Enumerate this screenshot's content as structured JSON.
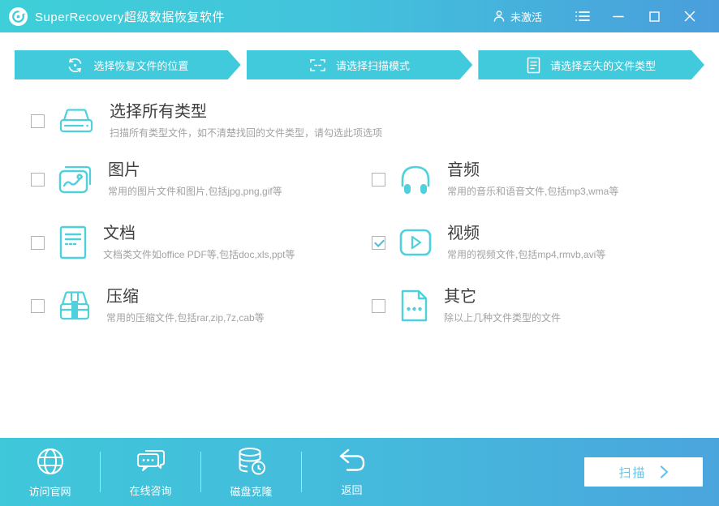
{
  "titlebar": {
    "title": "SuperRecovery超级数据恢复软件",
    "activation": "未激活"
  },
  "steps": [
    {
      "label": "选择恢复文件的位置"
    },
    {
      "label": "请选择扫描模式"
    },
    {
      "label": "请选择丢失的文件类型"
    }
  ],
  "file_types": {
    "all": {
      "title": "选择所有类型",
      "desc": "扫描所有类型文件，如不清楚找回的文件类型，请勾选此项选项",
      "checked": false
    },
    "image": {
      "title": "图片",
      "desc": "常用的图片文件和图片,包括jpg,png,gif等",
      "checked": false
    },
    "audio": {
      "title": "音频",
      "desc": "常用的音乐和语音文件,包括mp3,wma等",
      "checked": false
    },
    "document": {
      "title": "文档",
      "desc": "文档类文件如office PDF等,包括doc,xls,ppt等",
      "checked": false
    },
    "video": {
      "title": "视频",
      "desc": "常用的视频文件,包括mp4,rmvb,avi等",
      "checked": true
    },
    "archive": {
      "title": "压缩",
      "desc": "常用的压缩文件,包括rar,zip,7z,cab等",
      "checked": false
    },
    "other": {
      "title": "其它",
      "desc": "除以上几种文件类型的文件",
      "checked": false
    }
  },
  "footer": {
    "items": [
      {
        "label": "访问官网"
      },
      {
        "label": "在线咨询"
      },
      {
        "label": "磁盘克隆"
      },
      {
        "label": "返回"
      }
    ],
    "scan_label": "扫描"
  },
  "colors": {
    "titlebar_left": "#3ecfd8",
    "titlebar_right": "#4a9edc",
    "step_bg": "#41c9dc",
    "icon_cyan": "#4ed0dd",
    "check_mark": "#53b9d1",
    "scan_text": "#66c2e8"
  }
}
